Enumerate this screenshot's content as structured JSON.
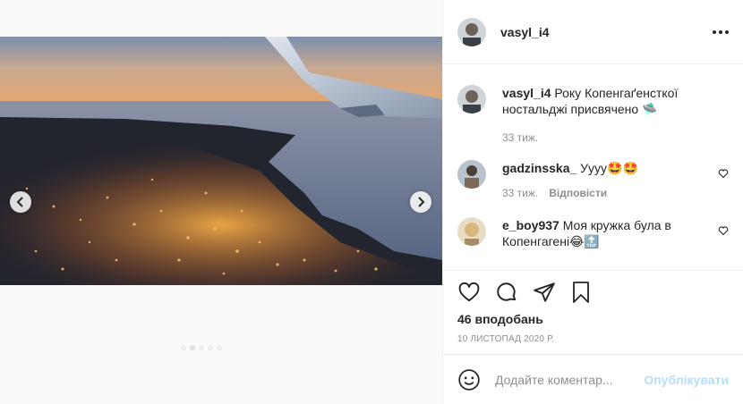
{
  "post": {
    "author": "vasyl_i4",
    "likes": "46 вподобань",
    "date": "10 листопад 2020 р."
  },
  "caption": {
    "username": "vasyl_i4",
    "text": "Року Копенгаґенсткої ностальджі присвячено",
    "emoji": "🛸",
    "time": "33 тиж."
  },
  "comments": [
    {
      "username": "gadzinsska_",
      "text": "Уууу🤩🤩",
      "time": "33 тиж.",
      "reply_label": "Відповісти"
    },
    {
      "username": "e_boy937",
      "text": "Моя кружка була в Копенгагені😂🔝"
    }
  ],
  "comment_input": {
    "placeholder": "Додайте коментар...",
    "submit_label": "Опублікувати"
  },
  "icons": {
    "like": "heart-icon",
    "comment": "comment-icon",
    "share": "share-icon",
    "save": "bookmark-icon",
    "emoji": "emoji-icon",
    "more": "more-icon",
    "prev": "chevron-left-icon",
    "next": "chevron-right-icon"
  },
  "colors": {
    "publish": "#b2dffc",
    "muted": "#8e8e8e",
    "border": "#efefef"
  }
}
